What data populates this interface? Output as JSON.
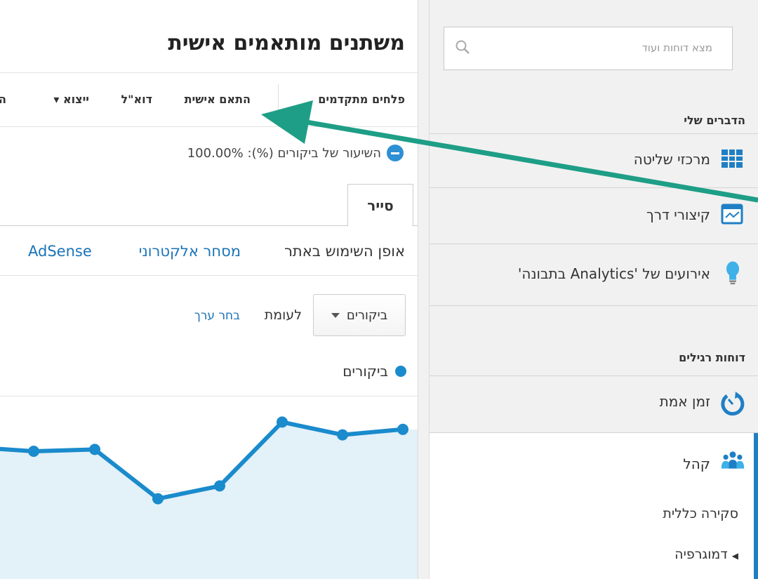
{
  "main": {
    "title": "משתנים מותאמים אישית",
    "toolbar": {
      "advanced_segments": "פלחים מתקדמים",
      "customize": "התאם אישית",
      "email": "דוא\"ל",
      "export": "ייצוא ▾",
      "add": "ה"
    },
    "metric_summary": "השיעור של ביקורים (%): 100.00%",
    "active_tab": "סייר",
    "subtabs": [
      "אופן השימוש באתר",
      "מסחר אלקטרוני",
      "AdSense"
    ],
    "metric_select": "ביקורים",
    "versus_label": "לעומת",
    "select_value_link": "בחר ערך",
    "legend_label": "ביקורים"
  },
  "chart_data": {
    "type": "area",
    "series": [
      {
        "name": "ביקורים",
        "color": "#1a8bcc",
        "values": [
          0.72,
          0.7,
          0.71,
          0.44,
          0.51,
          0.86,
          0.79,
          0.82
        ]
      }
    ],
    "ylim": [
      0,
      1
    ],
    "grid": true
  },
  "sidebar": {
    "search_placeholder": "מצא דוחות ועוד",
    "my_stuff_heading": "הדברים שלי",
    "items": [
      {
        "label": "מרכזי שליטה",
        "icon": "dashboard-grid-icon"
      },
      {
        "label": "קיצורי דרך",
        "icon": "shortcuts-icon"
      },
      {
        "label": "אירועים של 'Analytics בתבונה'",
        "icon": "lightbulb-icon"
      }
    ],
    "standard_reports_heading": "דוחות רגילים",
    "reports": [
      {
        "label": "זמן אמת",
        "icon": "real-time-icon"
      },
      {
        "label": "קהל",
        "icon": "audience-icon"
      }
    ],
    "audience_sub": [
      "סקירה כללית",
      "דמוגרפיה"
    ]
  },
  "colors": {
    "accent_blue": "#1f7fc5",
    "link_blue": "#1a73b8",
    "arrow_teal": "#1e9e86",
    "chart_fill": "#e3f1f8"
  }
}
